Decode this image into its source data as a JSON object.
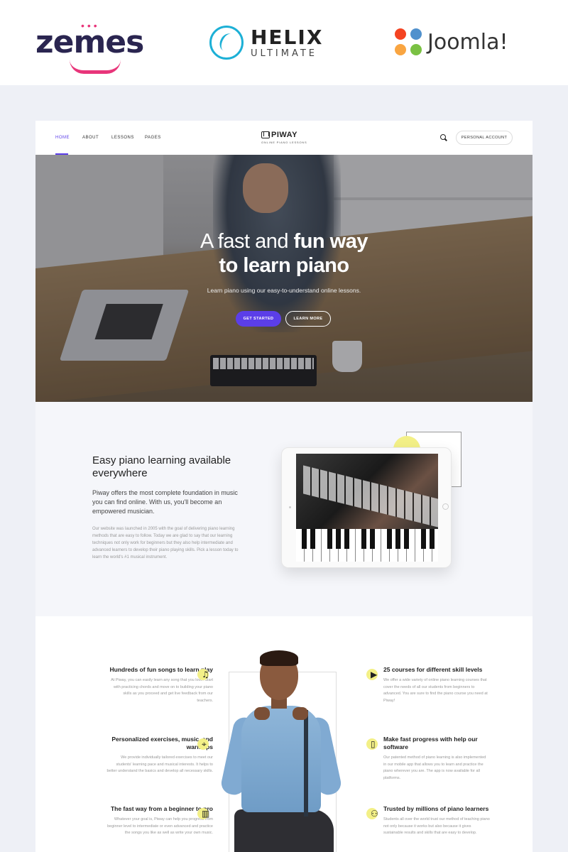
{
  "brands": {
    "zemes": "zemes",
    "helix_name": "HELIX",
    "helix_sub": "ULTIMATE",
    "joomla": "Joomla!"
  },
  "nav": {
    "items": [
      "HOME",
      "ABOUT",
      "LESSONS",
      "PAGES"
    ],
    "active": "HOME",
    "logo_name": "PIWAY",
    "logo_tagline": "ONLINE PIANO LESSONS",
    "search_icon": "search-icon",
    "account_label": "PERSONAL ACCOUNT"
  },
  "hero": {
    "title_light": "A fast and ",
    "title_bold": "fun way",
    "title_line2": "to learn piano",
    "subtitle": "Learn piano using our easy-to-understand online lessons.",
    "primary_button": "GET STARTED",
    "secondary_button": "LEARN MORE"
  },
  "about": {
    "title": "Easy piano learning available everywhere",
    "lead": "Piway offers the most complete foundation in music you can find online. With us, you'll become an empowered musician.",
    "body": "Our website was launched in 2005 with the goal of delivering piano learning methods that are easy to follow. Today we are glad to say that our learning techniques not only work for beginners but they also help intermediate and advanced learners to develop their piano playing skills. Pick a lesson today to learn the world's #1 musical instrument."
  },
  "features": {
    "left": [
      {
        "title": "Hundreds of fun songs to learn play",
        "text": "At Piway, you can easily learn any song that you love. Start with practicing chords and move on to building your piano skills as you proceed and get live feedback from our teachers.",
        "icon": "music-note-icon",
        "glyph": "♫"
      },
      {
        "title": "Personalized exercises, music, and warmups",
        "text": "We provide individually tailored exercises to meet our students' learning pace and musical interests. It helps to better understand the basics and develop all necessary skills.",
        "icon": "target-icon",
        "glyph": "⌖"
      },
      {
        "title": "The fast way from a beginner to pro",
        "text": "Whatever your goal is, Piway can help you progress from beginner level to intermediate or even advanced and practice the songs you like as well as write your own music.",
        "icon": "map-icon",
        "glyph": "▥"
      }
    ],
    "right": [
      {
        "title": "25 courses for different skill levels",
        "text": "We offer a wide variety of online piano learning courses that cover the needs of all our students from beginners to advanced. You are sure to find the piano course you need at Piway!",
        "icon": "video-icon",
        "glyph": "▶"
      },
      {
        "title": "Make fast progress with help our software",
        "text": "Our patented method of piano learning is also implemented in our mobile app that allows you to learn and practice the piano wherever you are. The app is now available for all platforms.",
        "icon": "tablet-icon",
        "glyph": "▯"
      },
      {
        "title": "Trusted by millions of piano learners",
        "text": "Students all over the world trust our method of teaching piano not only because it works but also because it gives sustainable results and skills that are easy to develop.",
        "icon": "users-icon",
        "glyph": "⚇"
      }
    ]
  },
  "colors": {
    "accent": "#5b3ee8",
    "highlight": "#f3f087",
    "zemes_pink": "#e8357a",
    "helix_blue": "#1db0d6"
  }
}
